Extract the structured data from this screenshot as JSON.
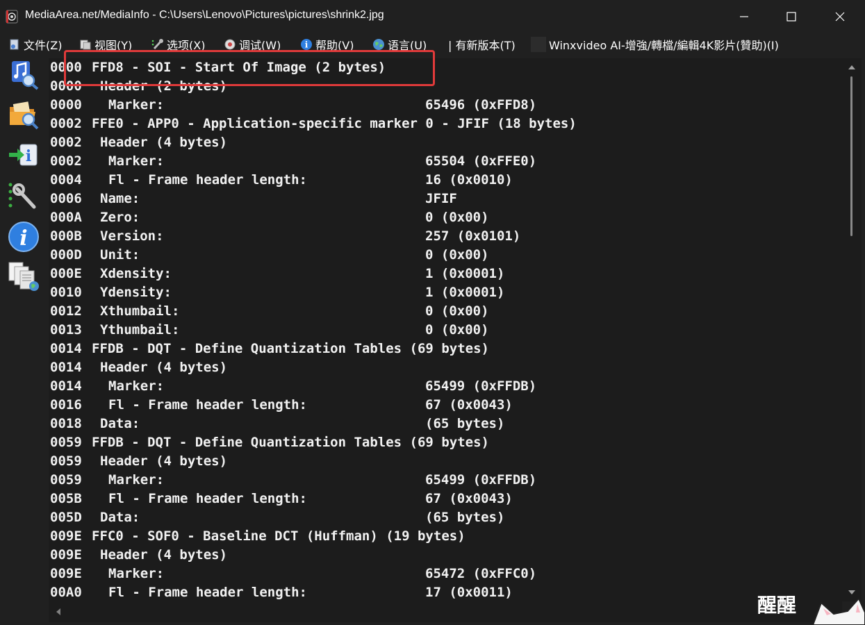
{
  "window": {
    "title": "MediaArea.net/MediaInfo - C:\\Users\\Lenovo\\Pictures\\pictures\\shrink2.jpg",
    "minimize_icon": "minimize-icon",
    "maximize_icon": "maximize-icon",
    "close_icon": "close-icon"
  },
  "menu": {
    "items": [
      {
        "label": "文件(Z)",
        "icon": "file-icon"
      },
      {
        "label": "视图(Y)",
        "icon": "view-icon"
      },
      {
        "label": "选项(X)",
        "icon": "options-icon"
      },
      {
        "label": "调试(W)",
        "icon": "debug-icon"
      },
      {
        "label": "帮助(V)",
        "icon": "help-icon"
      },
      {
        "label": "语言(U)",
        "icon": "language-icon"
      },
      {
        "label": "| 有新版本(T)",
        "icon": ""
      },
      {
        "label": "Winxvideo AI-增強/轉檔/編輯4K影片(贊助)(I)",
        "icon": "sponsor-icon"
      }
    ]
  },
  "toolbar": {
    "items": [
      {
        "name": "open-file-icon"
      },
      {
        "name": "open-folder-icon"
      },
      {
        "name": "export-icon"
      },
      {
        "name": "preferences-icon"
      },
      {
        "name": "about-icon"
      },
      {
        "name": "sheet-view-icon"
      }
    ]
  },
  "lines": [
    {
      "off": "0000",
      "desc": "FFD8 - SOI - Start Of Image (2 bytes)",
      "val": "",
      "indent": 0
    },
    {
      "off": "0000",
      "desc": "Header (2 bytes)",
      "val": "",
      "indent": 1
    },
    {
      "off": "0000",
      "desc": "Marker:",
      "val": "65496 (0xFFD8)",
      "indent": 2
    },
    {
      "off": "0002",
      "desc": "FFE0 - APP0 - Application-specific marker 0 - JFIF (18 bytes)",
      "val": "",
      "indent": 0
    },
    {
      "off": "0002",
      "desc": "Header (4 bytes)",
      "val": "",
      "indent": 1
    },
    {
      "off": "0002",
      "desc": "Marker:",
      "val": "65504 (0xFFE0)",
      "indent": 2
    },
    {
      "off": "0004",
      "desc": "Fl - Frame header length:",
      "val": "16 (0x0010)",
      "indent": 2
    },
    {
      "off": "0006",
      "desc": "Name:",
      "val": "JFIF",
      "indent": 1
    },
    {
      "off": "000A",
      "desc": "Zero:",
      "val": "0 (0x00)",
      "indent": 1
    },
    {
      "off": "000B",
      "desc": "Version:",
      "val": "257 (0x0101)",
      "indent": 1
    },
    {
      "off": "000D",
      "desc": "Unit:",
      "val": "0 (0x00)",
      "indent": 1
    },
    {
      "off": "000E",
      "desc": "Xdensity:",
      "val": "1 (0x0001)",
      "indent": 1
    },
    {
      "off": "0010",
      "desc": "Ydensity:",
      "val": "1 (0x0001)",
      "indent": 1
    },
    {
      "off": "0012",
      "desc": "Xthumbail:",
      "val": "0 (0x00)",
      "indent": 1
    },
    {
      "off": "0013",
      "desc": "Ythumbail:",
      "val": "0 (0x00)",
      "indent": 1
    },
    {
      "off": "0014",
      "desc": "FFDB - DQT - Define Quantization Tables (69 bytes)",
      "val": "",
      "indent": 0
    },
    {
      "off": "0014",
      "desc": "Header (4 bytes)",
      "val": "",
      "indent": 1
    },
    {
      "off": "0014",
      "desc": "Marker:",
      "val": "65499 (0xFFDB)",
      "indent": 2
    },
    {
      "off": "0016",
      "desc": "Fl - Frame header length:",
      "val": "67 (0x0043)",
      "indent": 2
    },
    {
      "off": "0018",
      "desc": "Data:",
      "val": "(65 bytes)",
      "indent": 1
    },
    {
      "off": "0059",
      "desc": "FFDB - DQT - Define Quantization Tables (69 bytes)",
      "val": "",
      "indent": 0
    },
    {
      "off": "0059",
      "desc": "Header (4 bytes)",
      "val": "",
      "indent": 1
    },
    {
      "off": "0059",
      "desc": "Marker:",
      "val": "65499 (0xFFDB)",
      "indent": 2
    },
    {
      "off": "005B",
      "desc": "Fl - Frame header length:",
      "val": "67 (0x0043)",
      "indent": 2
    },
    {
      "off": "005D",
      "desc": "Data:",
      "val": "(65 bytes)",
      "indent": 1
    },
    {
      "off": "009E",
      "desc": "FFC0 - SOF0 - Baseline DCT (Huffman) (19 bytes)",
      "val": "",
      "indent": 0
    },
    {
      "off": "009E",
      "desc": "Header (4 bytes)",
      "val": "",
      "indent": 1
    },
    {
      "off": "009E",
      "desc": "Marker:",
      "val": "65472 (0xFFC0)",
      "indent": 2
    },
    {
      "off": "00A0",
      "desc": "Fl - Frame header length:",
      "val": "17 (0x0011)",
      "indent": 2
    }
  ],
  "watermark": {
    "text": "醒醒"
  },
  "colors": {
    "highlight": "#e03a3a",
    "background": "#202020",
    "content_bg": "#1c1c1c"
  }
}
